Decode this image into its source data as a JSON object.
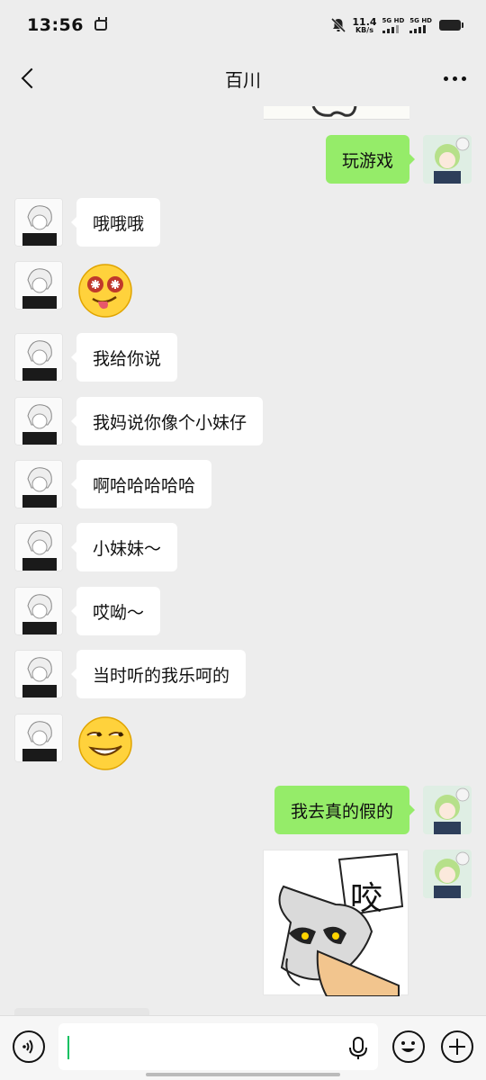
{
  "status_bar": {
    "time": "13:56",
    "net_speed_value": "11.4",
    "net_speed_unit": "KB/s",
    "signal_label_1": "5G HD",
    "signal_label_2": "5G HD"
  },
  "header": {
    "title": "百川"
  },
  "messages": [
    {
      "side": "right",
      "type": "text",
      "text": "玩游戏"
    },
    {
      "side": "left",
      "type": "text",
      "text": "哦哦哦"
    },
    {
      "side": "left",
      "type": "emoji",
      "icon": "tongue-out-star-eyes-emoji"
    },
    {
      "side": "left",
      "type": "text",
      "text": "我给你说"
    },
    {
      "side": "left",
      "type": "text",
      "text": "我妈说你像个小妹仔"
    },
    {
      "side": "left",
      "type": "text",
      "text": "啊哈哈哈哈哈"
    },
    {
      "side": "left",
      "type": "text",
      "text": "小妹妹～"
    },
    {
      "side": "left",
      "type": "text",
      "text": "哎呦～"
    },
    {
      "side": "left",
      "type": "text",
      "text": "当时听的我乐呵的"
    },
    {
      "side": "left",
      "type": "emoji",
      "icon": "smirk-emoji"
    },
    {
      "side": "right",
      "type": "text",
      "text": "我去真的假的"
    },
    {
      "side": "right",
      "type": "sticker",
      "text": "咬",
      "icon": "cat-biting-sticker"
    }
  ],
  "input": {
    "value": ""
  },
  "colors": {
    "background": "#ededed",
    "my_bubble": "#95ec69",
    "other_bubble": "#ffffff",
    "caret": "#07c160"
  }
}
